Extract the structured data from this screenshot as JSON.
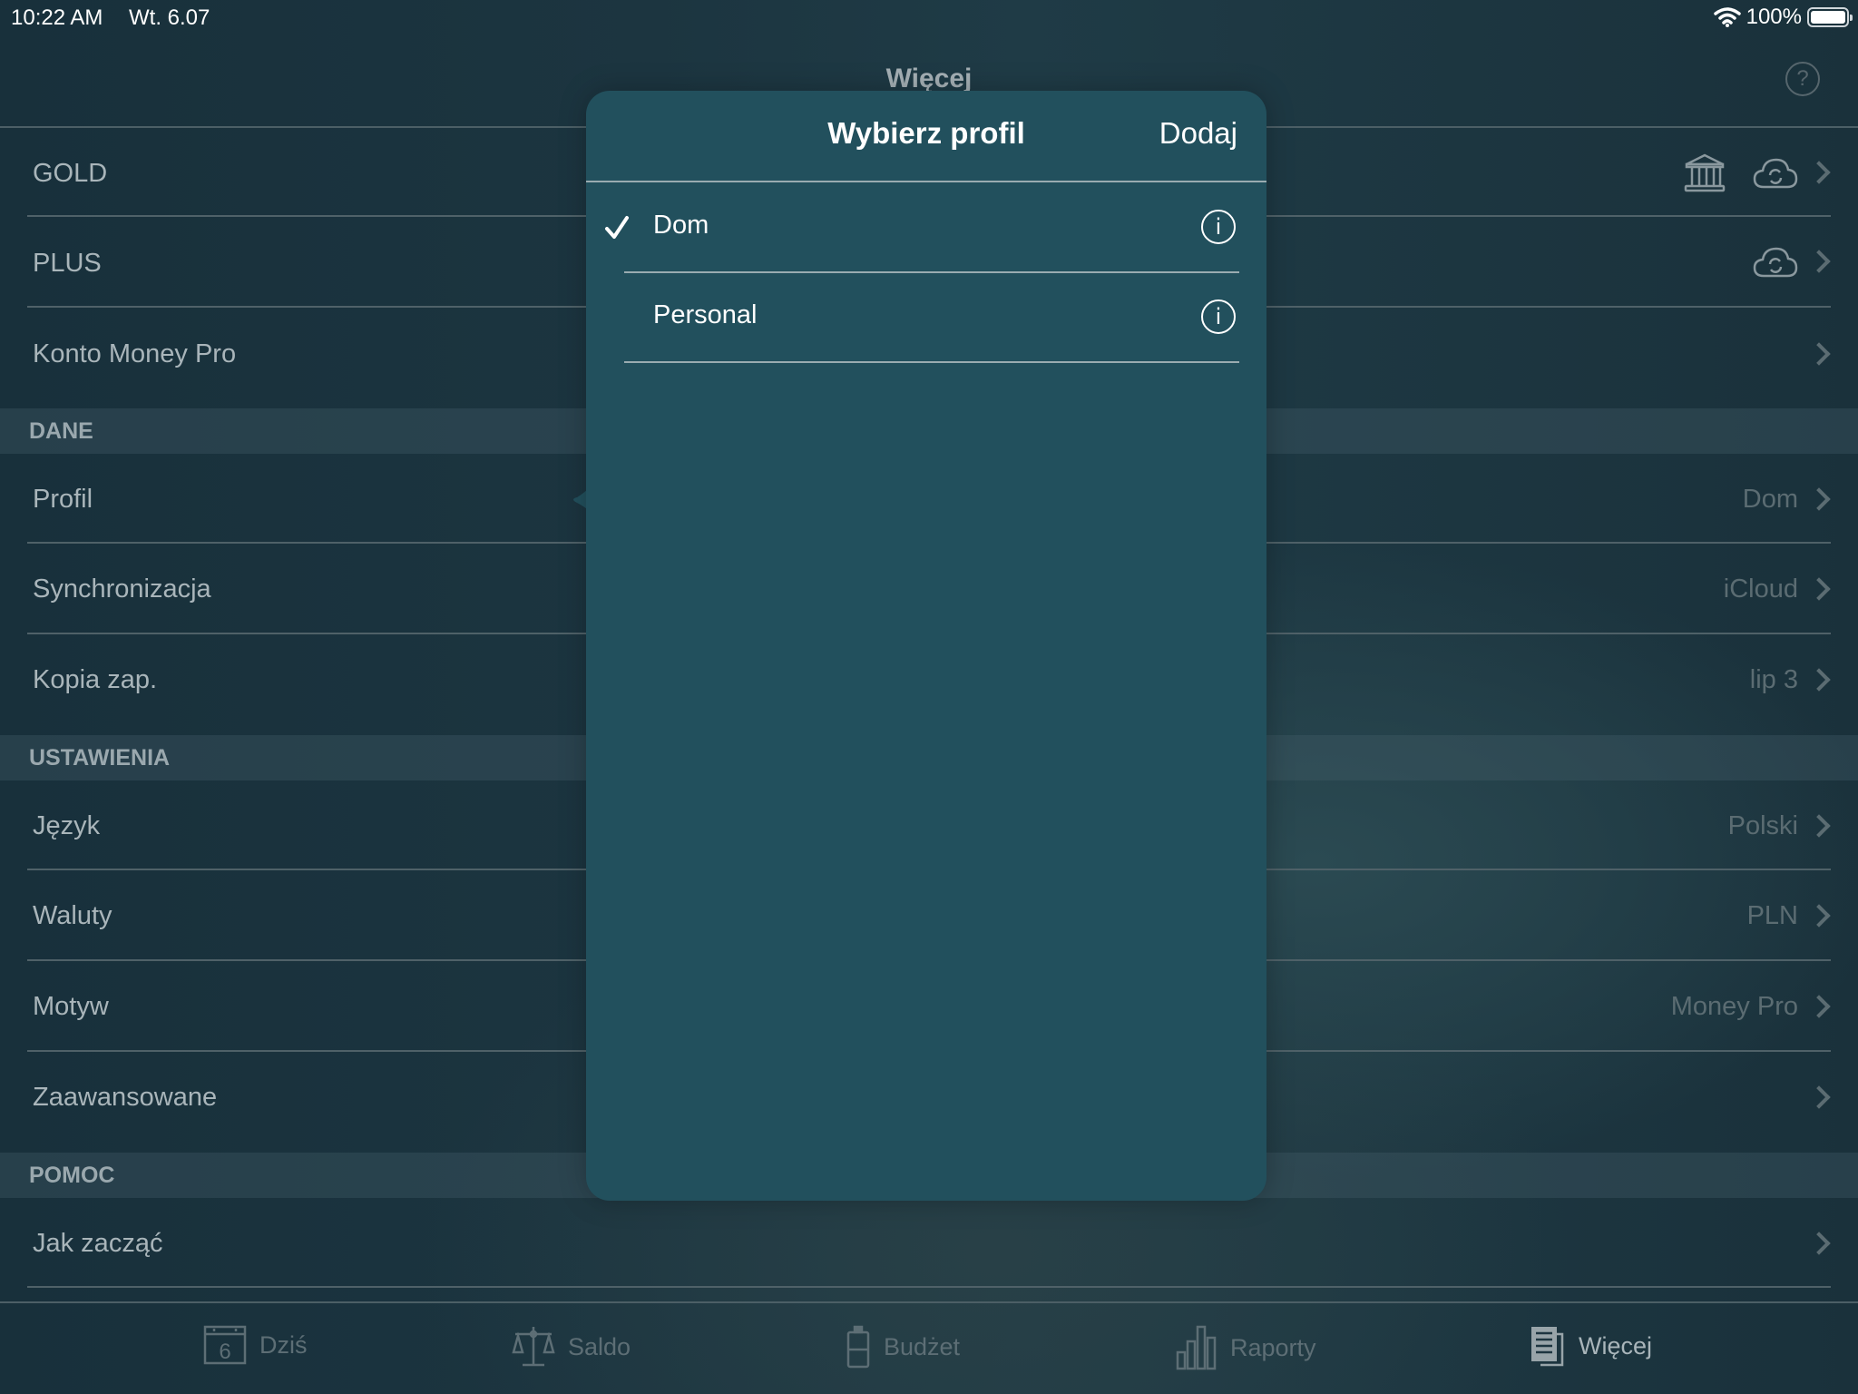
{
  "status_bar": {
    "time": "10:22 AM",
    "date": "Wt. 6.07",
    "battery_text": "100%",
    "battery_level": 1.0,
    "wifi_icon": "wifi-icon"
  },
  "nav": {
    "title": "Więcej",
    "help_label": "?"
  },
  "list": {
    "rows_top": [
      {
        "label": "GOLD",
        "icons": [
          "bank-icon",
          "cloud-sync-icon"
        ]
      },
      {
        "label": "PLUS",
        "icons": [
          "cloud-sync-icon"
        ]
      },
      {
        "label": "Konto Money Pro",
        "value": ""
      }
    ],
    "sections": [
      {
        "title": "DANE",
        "items": [
          {
            "label": "Profil",
            "value": "Dom"
          },
          {
            "label": "Synchronizacja",
            "value": "iCloud"
          },
          {
            "label": "Kopia zap.",
            "value": "lip 3"
          }
        ]
      },
      {
        "title": "USTAWIENIA",
        "items": [
          {
            "label": "Język",
            "value": "Polski"
          },
          {
            "label": "Waluty",
            "value": "PLN"
          },
          {
            "label": "Motyw",
            "value": "Money Pro"
          },
          {
            "label": "Zaawansowane",
            "value": ""
          }
        ]
      },
      {
        "title": "POMOC",
        "items": [
          {
            "label": "Jak zacząć",
            "value": ""
          }
        ]
      }
    ]
  },
  "tabbar": {
    "tabs": [
      {
        "label": "Dziś",
        "icon": "calendar-icon",
        "calendar_day": "6",
        "active": false
      },
      {
        "label": "Saldo",
        "icon": "scales-icon",
        "active": false
      },
      {
        "label": "Budżet",
        "icon": "budget-jar-icon",
        "active": false
      },
      {
        "label": "Raporty",
        "icon": "bar-chart-icon",
        "active": false
      },
      {
        "label": "Więcej",
        "icon": "document-icon",
        "active": true
      }
    ]
  },
  "popover": {
    "title": "Wybierz profil",
    "add_label": "Dodaj",
    "profiles": [
      {
        "name": "Dom",
        "selected": true,
        "info_label": "i"
      },
      {
        "name": "Personal",
        "selected": false,
        "info_label": "i"
      }
    ]
  },
  "colors": {
    "popover_bg": "#22505d",
    "background": "#1c3540",
    "secondary_text": "#a9b5ba",
    "value_text": "#5b6c72"
  }
}
